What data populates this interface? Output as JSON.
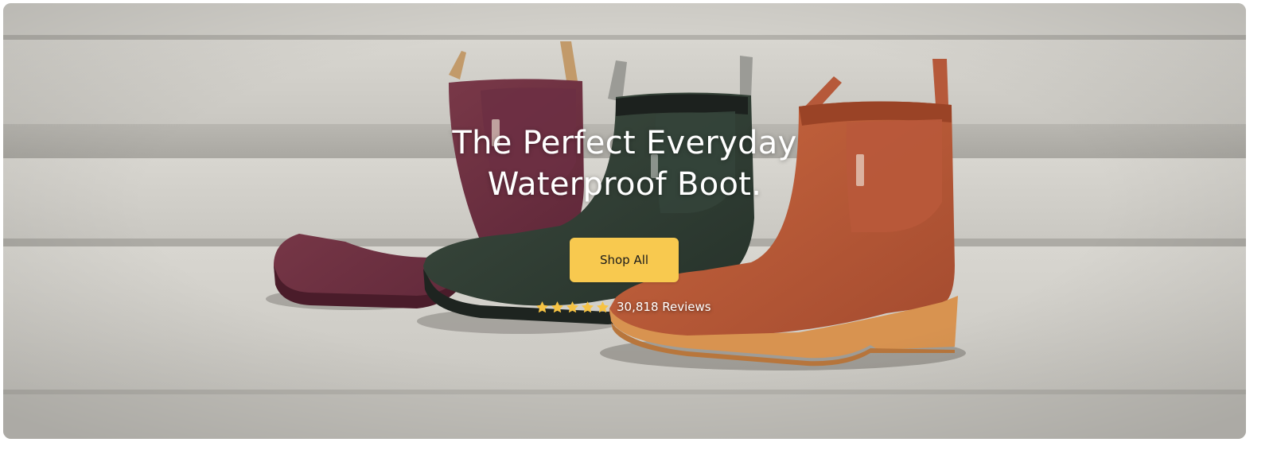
{
  "hero": {
    "headline_line1": "The Perfect Everyday",
    "headline_line2": "Waterproof Boot.",
    "cta_label": "Shop All",
    "rating": {
      "stars": 5,
      "reviews_label": "30,818 Reviews"
    },
    "boots": [
      {
        "color_name": "plum",
        "color": "#6e3044"
      },
      {
        "color_name": "forest-green",
        "color": "#2f3d32"
      },
      {
        "color_name": "terracotta",
        "color": "#b8593a"
      }
    ]
  },
  "colors": {
    "cta_background": "#f8c94f",
    "headline_text": "#ffffff",
    "star": "#f6c344"
  },
  "icons": {
    "star": "star-icon"
  }
}
